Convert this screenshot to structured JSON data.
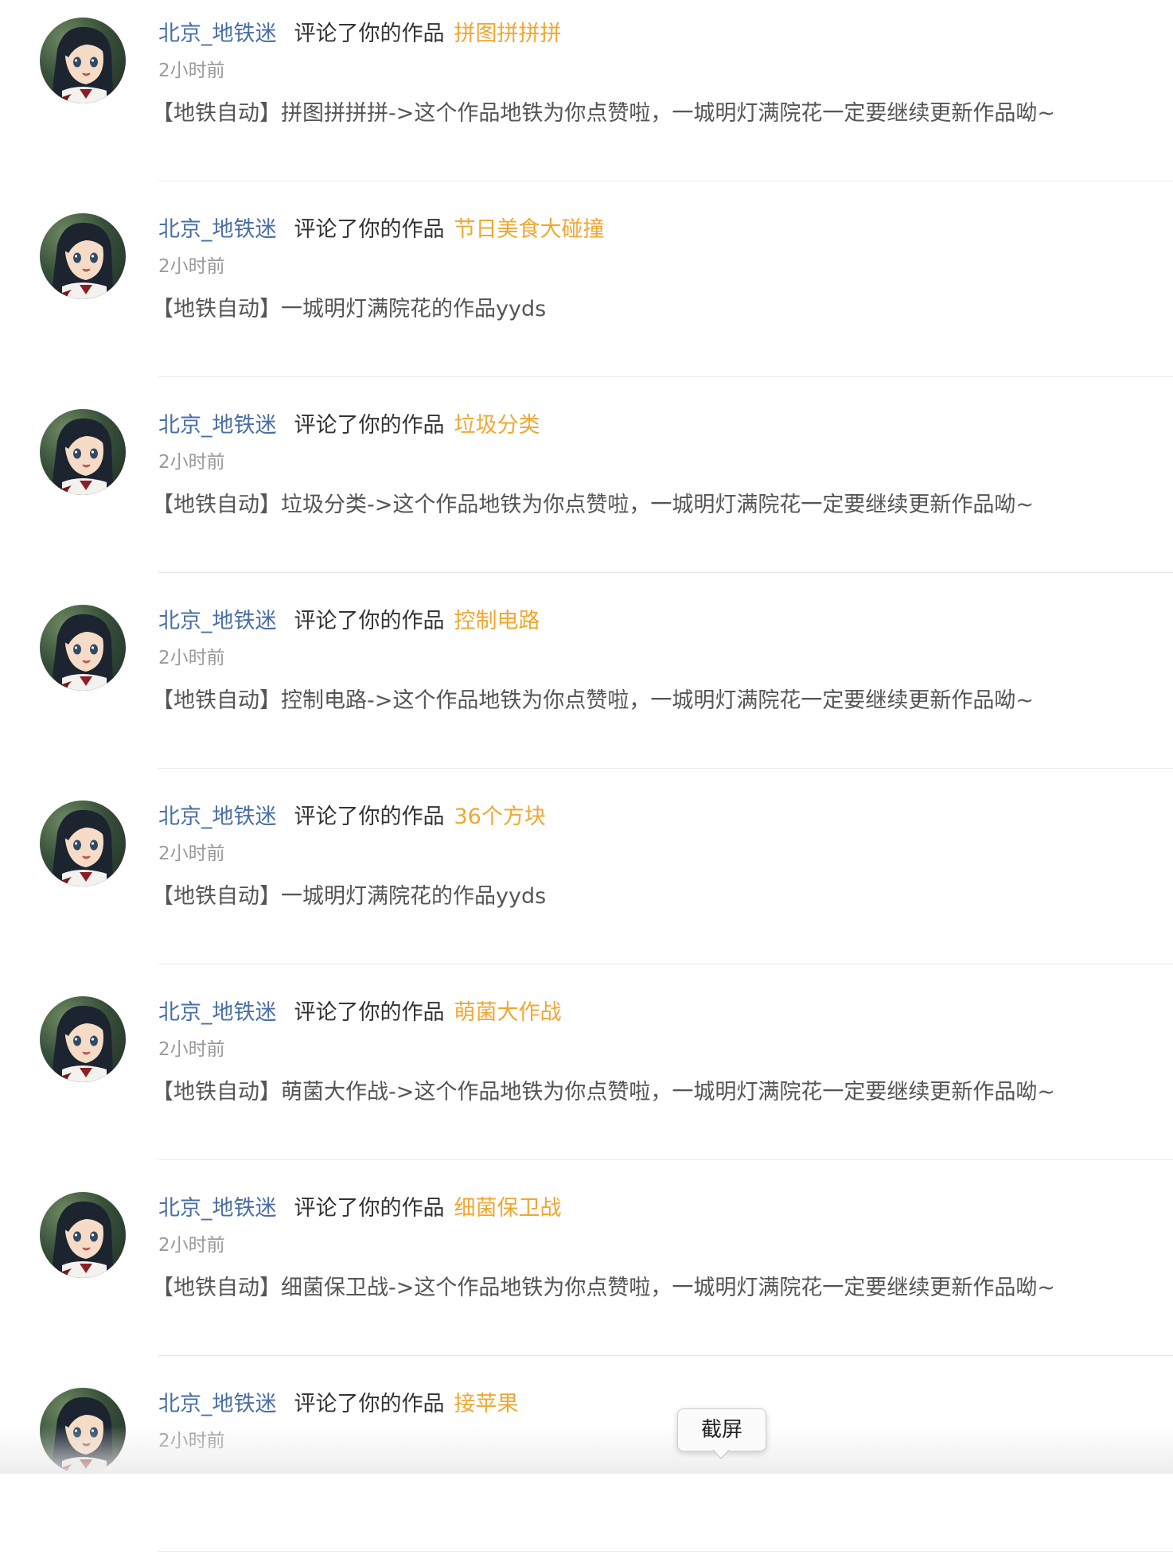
{
  "notifications": [
    {
      "user": "北京_地铁迷",
      "action": "评论了你的作品",
      "work": "拼图拼拼拼",
      "time": "2小时前",
      "comment": "【地铁自动】拼图拼拼拼->这个作品地铁为你点赞啦，一城明灯满院花一定要继续更新作品呦~"
    },
    {
      "user": "北京_地铁迷",
      "action": "评论了你的作品",
      "work": "节日美食大碰撞",
      "time": "2小时前",
      "comment": "【地铁自动】一城明灯满院花的作品yyds"
    },
    {
      "user": "北京_地铁迷",
      "action": "评论了你的作品",
      "work": "垃圾分类",
      "time": "2小时前",
      "comment": "【地铁自动】垃圾分类->这个作品地铁为你点赞啦，一城明灯满院花一定要继续更新作品呦~"
    },
    {
      "user": "北京_地铁迷",
      "action": "评论了你的作品",
      "work": "控制电路",
      "time": "2小时前",
      "comment": "【地铁自动】控制电路->这个作品地铁为你点赞啦，一城明灯满院花一定要继续更新作品呦~"
    },
    {
      "user": "北京_地铁迷",
      "action": "评论了你的作品",
      "work": "36个方块",
      "time": "2小时前",
      "comment": "【地铁自动】一城明灯满院花的作品yyds"
    },
    {
      "user": "北京_地铁迷",
      "action": "评论了你的作品",
      "work": "萌菌大作战",
      "time": "2小时前",
      "comment": "【地铁自动】萌菌大作战->这个作品地铁为你点赞啦，一城明灯满院花一定要继续更新作品呦~"
    },
    {
      "user": "北京_地铁迷",
      "action": "评论了你的作品",
      "work": "细菌保卫战",
      "time": "2小时前",
      "comment": "【地铁自动】细菌保卫战->这个作品地铁为你点赞啦，一城明灯满院花一定要继续更新作品呦~"
    },
    {
      "user": "北京_地铁迷",
      "action": "评论了你的作品",
      "work": "接苹果",
      "time": "2小时前",
      "comment": ""
    }
  ],
  "tooltip": {
    "label": "截屏"
  },
  "colors": {
    "user_link": "#4a6fa5",
    "work_link": "#f0a732",
    "text": "#333333",
    "muted": "#9a9a9a"
  }
}
